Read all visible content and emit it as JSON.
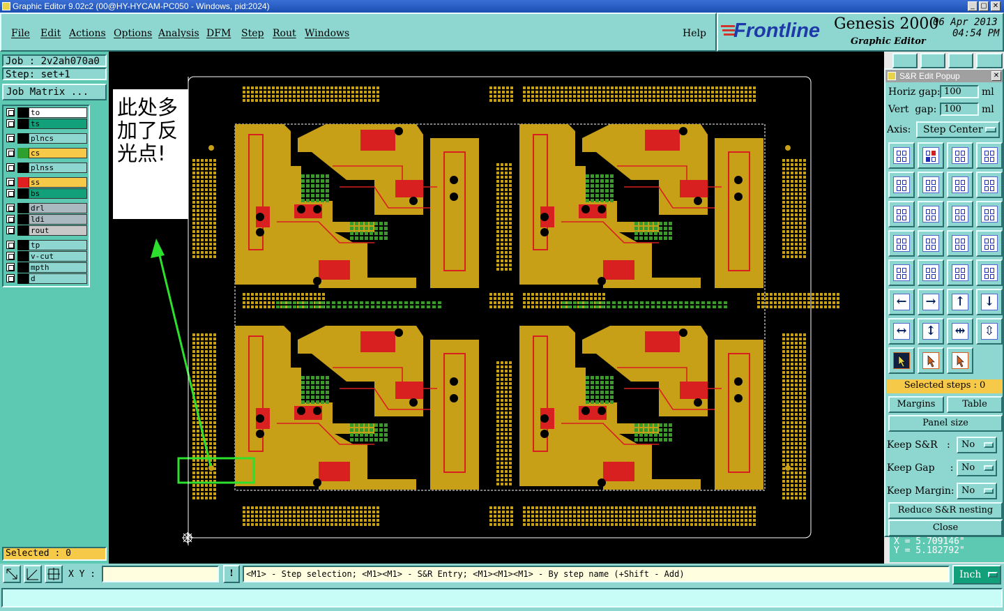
{
  "window": {
    "title": "Graphic Editor 9.02c2 (00@HY-HYCAM-PC050 - Windows, pid:2024)",
    "min": "_",
    "max": "▢",
    "close": "✕"
  },
  "menu": [
    "File",
    "Edit",
    "Actions",
    "Options",
    "Analysis",
    "DFM",
    "Step",
    "Rout",
    "Windows"
  ],
  "help": "Help",
  "logo": {
    "brand": "Frontline",
    "product": "Genesis 2000",
    "subtitle": "Graphic Editor",
    "date": "06 Apr 2013",
    "time": "04:54 PM"
  },
  "job": {
    "job_label": "Job : 2v2ah070a0",
    "step_label": "Step: set+1",
    "matrix_button": "Job Matrix ..."
  },
  "layers": [
    {
      "name": "to",
      "color": "#ffffff",
      "swatch": "#000000"
    },
    {
      "name": "ts",
      "color": "#12a07a",
      "swatch": "#000000"
    },
    {
      "name": "plncs",
      "color": "#8ed6d0",
      "swatch": "#000000"
    },
    {
      "name": "cs",
      "color": "#f7c948",
      "swatch": "#2fa030"
    },
    {
      "name": "plnss",
      "color": "#8ed6d0",
      "swatch": "#000000"
    },
    {
      "name": "ss",
      "color": "#f7c948",
      "swatch": "#e02020"
    },
    {
      "name": "bs",
      "color": "#12a07a",
      "swatch": "#000000"
    },
    {
      "name": "drl",
      "color": "#aab8bf",
      "swatch": "#000000"
    },
    {
      "name": "ldi",
      "color": "#aab8bf",
      "swatch": "#000000"
    },
    {
      "name": "rout",
      "color": "#c8c8c8",
      "swatch": "#000000"
    },
    {
      "name": "tp",
      "color": "#8ed6d0",
      "swatch": "#000000"
    },
    {
      "name": "v-cut",
      "color": "#8ed6d0",
      "swatch": "#000000"
    },
    {
      "name": "mpth",
      "color": "#8ed6d0",
      "swatch": "#000000"
    },
    {
      "name": "d",
      "color": "#8ed6d0",
      "swatch": "#000000"
    }
  ],
  "selected_label": "Selected : 0",
  "annotation": {
    "line1": "此处多",
    "line2": "加了反",
    "line3": "光点!"
  },
  "popup": {
    "title": "S&R Edit Popup",
    "horiz_label": "Horiz gap:",
    "horiz_value": "100",
    "horiz_unit": "ml",
    "vert_label": "Vert  gap:",
    "vert_value": "100",
    "vert_unit": "ml",
    "axis_label": "Axis:",
    "axis_value": "Step Center",
    "selected_steps": "Selected steps : 0",
    "margins": "Margins",
    "table": "Table",
    "panel_size": "Panel size",
    "keep_sr_label": "Keep S&R   :",
    "keep_sr_value": "No",
    "keep_gap_label": "Keep Gap     :",
    "keep_gap_value": "No",
    "keep_margin_label": "Keep Margin:",
    "keep_margin_value": "No",
    "reduce": "Reduce S&R nesting",
    "close": "Close"
  },
  "coords": {
    "x": "X = 5.709146\"",
    "y": "Y = 5.182792\""
  },
  "bottom": {
    "xy_label": "X Y :",
    "xy_value": "",
    "excl": "!",
    "hint": "<M1> - Step selection; <M1><M1> - S&R Entry; <M1><M1><M1> - By step name (+Shift - Add)",
    "unit": "Inch"
  }
}
